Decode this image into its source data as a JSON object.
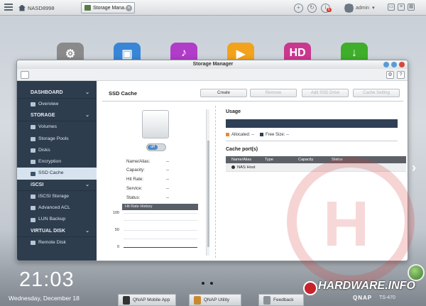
{
  "taskbar": {
    "home_label": "NASD8998",
    "tab_label": "Storage Mana...",
    "user_label": "admin",
    "notification_count": "6"
  },
  "desktop_apps": [
    {
      "name": "control-panel",
      "color": "#8a8a8a",
      "glyph": "⚙"
    },
    {
      "name": "photo-station",
      "color": "#3a86d6",
      "glyph": "▣"
    },
    {
      "name": "music-station",
      "color": "#b03cc9",
      "glyph": "♪"
    },
    {
      "name": "video-station",
      "color": "#f2a21b",
      "glyph": "▶"
    },
    {
      "name": "hd-station",
      "color": "#c9388f",
      "glyph": "HD"
    },
    {
      "name": "download-station",
      "color": "#3fae2a",
      "glyph": "↓"
    }
  ],
  "window": {
    "title": "Storage Manager"
  },
  "sidebar": {
    "sections": [
      {
        "title": "DASHBOARD",
        "items": [
          "Overview"
        ]
      },
      {
        "title": "STORAGE",
        "items": [
          "Volumes",
          "Storage Pools",
          "Disks",
          "Encryption",
          "SSD Cache"
        ]
      },
      {
        "title": "iSCSI",
        "items": [
          "iSCSI Storage",
          "Advanced ACL",
          "LUN Backup"
        ]
      },
      {
        "title": "VIRTUAL DISK",
        "items": [
          "Remote Disk"
        ]
      }
    ],
    "active_item": "SSD Cache"
  },
  "main": {
    "title": "SSD Cache",
    "buttons": {
      "create": "Create",
      "remove": "Remove",
      "add_ssd": "Add SSD Drive",
      "cache_setting": "Cache Setting"
    },
    "toggle_label": "off",
    "info": {
      "name_label": "Name/Alias:",
      "name_value": "--",
      "capacity_label": "Capacity:",
      "capacity_value": "--",
      "hitrate_label": "Hit Rate:",
      "hitrate_value": "--",
      "service_label": "Service:",
      "service_value": "--",
      "status_label": "Status:",
      "status_value": "--"
    },
    "hit_rate_history": {
      "title": "Hit Rate History",
      "ticks": [
        "100",
        "50",
        "0"
      ]
    },
    "usage": {
      "title": "Usage",
      "allocated_label": "Allocated: --",
      "free_label": "Free Size: --",
      "allocated_color": "#e8893a",
      "free_color": "#2f3f55"
    },
    "cache_ports": {
      "title": "Cache port(s)",
      "columns": [
        "Name/Alias",
        "Type",
        "Capacity",
        "Status"
      ],
      "rows": [
        [
          "NAS Host",
          "",
          "",
          ""
        ]
      ]
    }
  },
  "desktop": {
    "time": "21:03",
    "date": "Wednesday, December 18",
    "dock": [
      "QNAP Mobile App",
      "QNAP Utility",
      "Feedback"
    ],
    "brand": "HARDWARE.INFO",
    "qnap": "QNAP",
    "model": "TS-470"
  }
}
